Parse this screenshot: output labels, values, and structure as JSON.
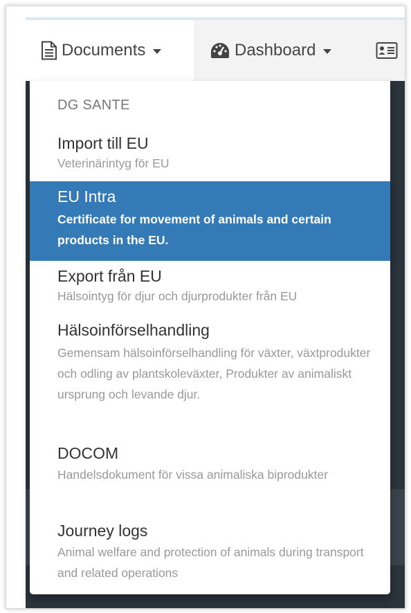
{
  "navbar": {
    "documents_label": "Documents",
    "dashboard_label": "Dashboard",
    "icons": {
      "documents": "document-icon",
      "dashboard": "dashboard-gauge-icon",
      "third": "id-card-icon"
    }
  },
  "dropdown": {
    "header": "DG SANTE",
    "items": [
      {
        "title": "Import till EU",
        "description": "Veterinärintyg för EU"
      },
      {
        "title": "EU Intra",
        "description": "Certificate for movement of animals and certain products in the EU."
      },
      {
        "title": "Export från EU",
        "description": "Hälsointyg för djur och djurprodukter från EU"
      },
      {
        "title": "Hälsoinförselhandling",
        "description": "Gemensam hälsoinförselhandling för växter, växtprodukter och odling av plantskoleväxter, Produkter av animaliskt ursprung och levande djur."
      },
      {
        "title": "DOCOM",
        "description": "Handelsdokument för vissa animaliska biprodukter"
      },
      {
        "title": "Journey logs",
        "description": "Animal welfare and protection of animals during transport and related operations"
      }
    ],
    "active_item": "EU Intra"
  },
  "colors": {
    "active_background": "#337ab7",
    "navbar_background": "#f3f3f3",
    "dark_band": "#2b333b",
    "text_primary": "#333333",
    "text_muted": "#999999"
  }
}
